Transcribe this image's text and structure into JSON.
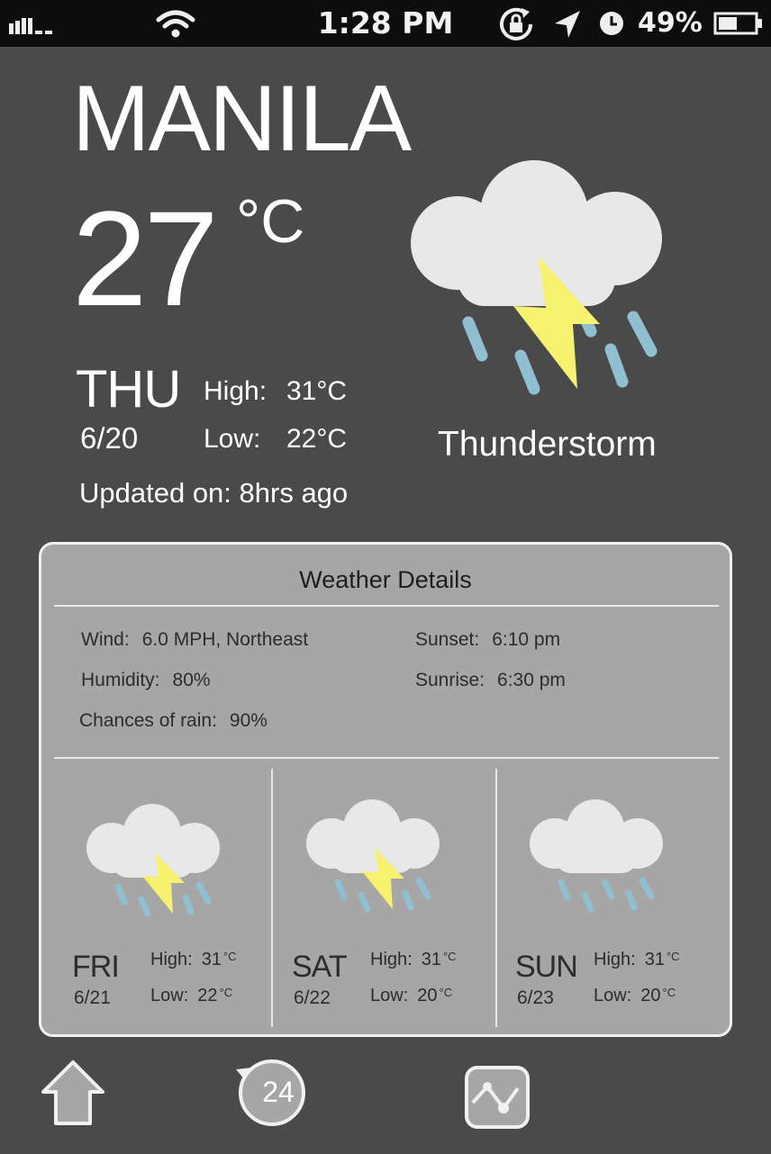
{
  "status_bar": {
    "time": "1:28 PM",
    "battery": "49%"
  },
  "current": {
    "city": "MANILA",
    "temperature": "27",
    "unit": "°C",
    "day": "THU",
    "date": "6/20",
    "high_label": "High:",
    "high": "31°C",
    "low_label": "Low:",
    "low": "22°C",
    "updated": "Updated on: 8hrs ago",
    "condition": "Thunderstorm",
    "icon": "thunderstorm-icon"
  },
  "details": {
    "title": "Weather Details",
    "wind_label": "Wind:",
    "wind": "6.0 MPH, Northeast",
    "humidity_label": "Humidity:",
    "humidity": "80%",
    "rain_label": "Chances of rain:",
    "rain": "90%",
    "sunset_label": "Sunset:",
    "sunset": "6:10 pm",
    "sunrise_label": "Sunrise:",
    "sunrise": "6:30 pm"
  },
  "forecast": [
    {
      "day": "FRI",
      "date": "6/21",
      "high_label": "High:",
      "high": "31",
      "low_label": "Low:",
      "low": "22",
      "unit": "°C",
      "icon": "thunderstorm-icon"
    },
    {
      "day": "SAT",
      "date": "6/22",
      "high_label": "High:",
      "high": "31",
      "low_label": "Low:",
      "low": "20",
      "unit": "°C",
      "icon": "thunderstorm-icon"
    },
    {
      "day": "SUN",
      "date": "6/23",
      "high_label": "High:",
      "high": "31",
      "low_label": "Low:",
      "low": "20",
      "unit": "°C",
      "icon": "rain-icon"
    }
  ],
  "nav": {
    "hourly_label": "24",
    "icons": [
      "home-icon",
      "24-hour-icon",
      "graph-icon"
    ]
  },
  "colors": {
    "background": "#4a4a4a",
    "cloud": "#e8e8e8",
    "bolt": "#f6f16e",
    "rain": "#8fbfd0",
    "panel": "#a6a6a6"
  }
}
